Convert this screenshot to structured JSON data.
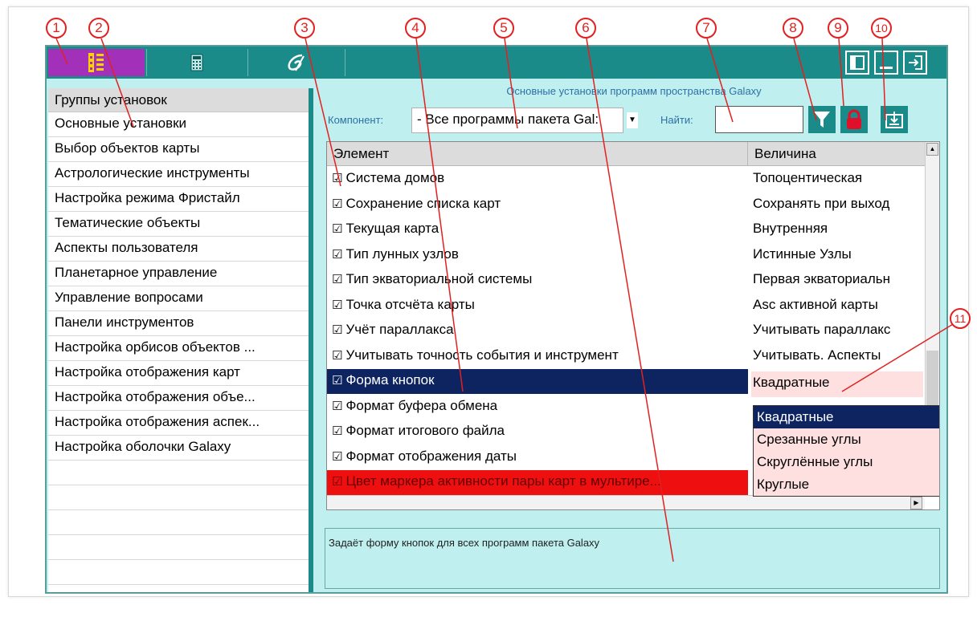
{
  "window": {
    "tabs": [
      {
        "icon": "settings-list-icon",
        "active": true
      },
      {
        "icon": "calculator-icon",
        "active": false
      },
      {
        "icon": "galaxy-logo-icon",
        "active": false
      }
    ],
    "window_buttons": [
      "panel-toggle-icon",
      "minimize-icon",
      "exit-icon"
    ]
  },
  "groups": {
    "header": "Группы установок",
    "items": [
      "Основные установки",
      "Выбор объектов карты",
      "Астрологические инструменты",
      "Настройка режима Фристайл",
      "Тематические объекты",
      "Аспекты пользователя",
      "Планетарное управление",
      "Управление вопросами",
      "Панели инструментов",
      "Настройка орбисов объектов ...",
      "Настройка отображения карт",
      "Настройка отображения объе...",
      "Настройка отображения аспек...",
      "Настройка оболочки Galaxy"
    ]
  },
  "right": {
    "title": "Основные установки программ пространства Galaxy",
    "component_label": "Компонент:",
    "component_value": "- Все программы пакета Gal:",
    "find_label": "Найти:",
    "find_value": ""
  },
  "table": {
    "col_element": "Элемент",
    "col_value": "Величина",
    "rows": [
      {
        "element": "Система домов",
        "value": "Топоцентическая"
      },
      {
        "element": "Сохранение списка карт",
        "value": "Сохранять при выход"
      },
      {
        "element": "Текущая карта",
        "value": "Внутренняя"
      },
      {
        "element": "Тип лунных узлов",
        "value": "Истинные Узлы"
      },
      {
        "element": "Тип экваториальной системы",
        "value": "Первая экваториальн"
      },
      {
        "element": "Точка отсчёта карты",
        "value": "Asc активной карты"
      },
      {
        "element": "Учёт параллакса",
        "value": "Учитывать параллакс"
      },
      {
        "element": "Учитывать точность события и инструмент",
        "value": "Учитывать. Аспекты"
      },
      {
        "element": "Форма кнопок",
        "value": "Квадратные",
        "selected": true
      },
      {
        "element": "Формат буфера обмена",
        "value": ""
      },
      {
        "element": "Формат итогового файла",
        "value": ""
      },
      {
        "element": "Формат отображения даты",
        "value": ""
      },
      {
        "element": "Цвет маркера активности пары карт в мультире...",
        "value": "",
        "highlight": "#ee1010"
      }
    ],
    "check_glyph": "☑"
  },
  "dropdown": {
    "options": [
      "Квадратные",
      "Срезанные углы",
      "Скруглённые углы",
      "Круглые"
    ],
    "active_index": 0
  },
  "description": "Задаёт форму кнопок для всех программ пакета Galaxy",
  "annotations": [
    "1",
    "2",
    "3",
    "4",
    "5",
    "6",
    "7",
    "8",
    "9",
    "10",
    "11"
  ],
  "colors": {
    "teal": "#1a8b88",
    "purple_tab": "#a330b8",
    "selected_row": "#0e2460",
    "dropdown_bg": "#ffe0e0",
    "annotation_red": "#e32020",
    "lock_red": "#e0102a"
  }
}
